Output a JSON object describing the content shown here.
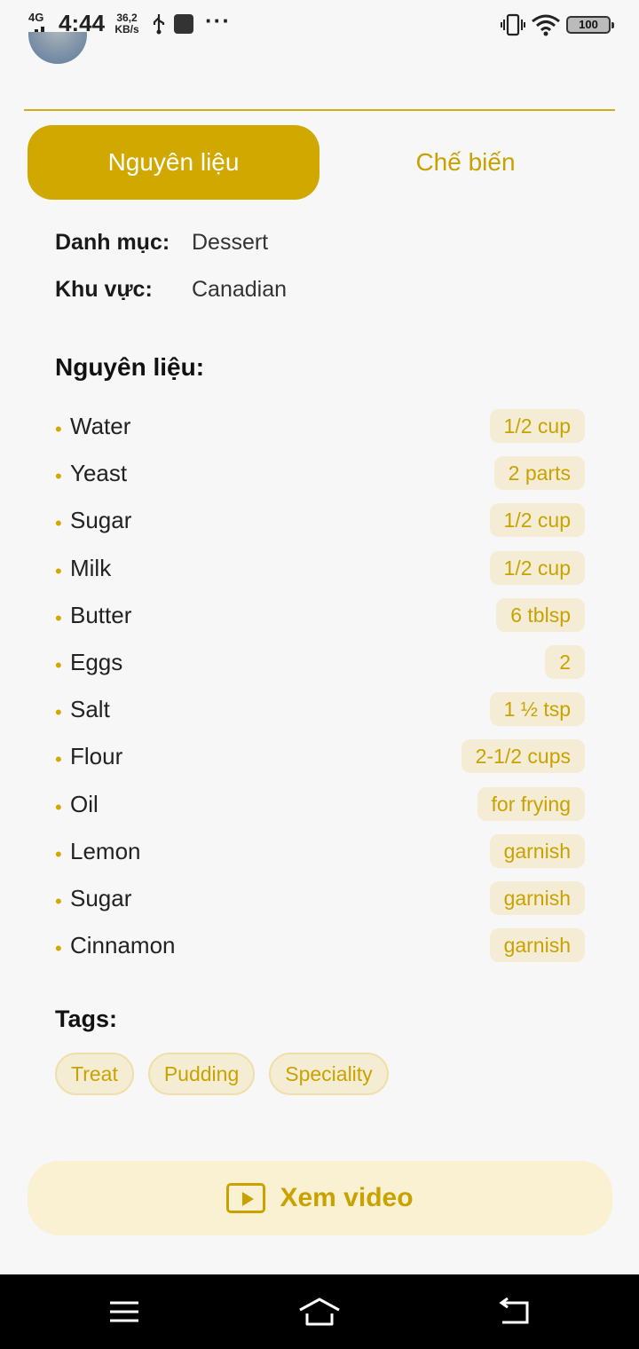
{
  "status_bar": {
    "network": "4G",
    "time": "4:44",
    "speed_value": "36,2",
    "speed_unit": "KB/s",
    "battery": "100",
    "icons": [
      "signal-icon",
      "usb-icon",
      "app-notification-icon",
      "more-notifications-icon",
      "vibrate-icon",
      "wifi-icon",
      "battery-icon"
    ]
  },
  "tabs": [
    {
      "label": "Nguyên liệu",
      "active": true
    },
    {
      "label": "Chế biến",
      "active": false
    }
  ],
  "info": {
    "category_label": "Danh mục:",
    "category_value": "Dessert",
    "area_label": "Khu vực:",
    "area_value": "Canadian"
  },
  "ingredients_title": "Nguyên liệu:",
  "ingredients": [
    {
      "name": "Water",
      "measure": "1/2 cup"
    },
    {
      "name": "Yeast",
      "measure": "2 parts"
    },
    {
      "name": "Sugar",
      "measure": "1/2 cup"
    },
    {
      "name": "Milk",
      "measure": "1/2 cup"
    },
    {
      "name": "Butter",
      "measure": "6 tblsp"
    },
    {
      "name": "Eggs",
      "measure": "2"
    },
    {
      "name": "Salt",
      "measure": "1 ½ tsp"
    },
    {
      "name": "Flour",
      "measure": "2-1/2 cups"
    },
    {
      "name": "Oil",
      "measure": "for frying"
    },
    {
      "name": "Lemon",
      "measure": "garnish"
    },
    {
      "name": "Sugar",
      "measure": "garnish"
    },
    {
      "name": "Cinnamon",
      "measure": "garnish"
    }
  ],
  "tags_title": "Tags:",
  "tags": [
    "Treat",
    "Pudding",
    "Speciality"
  ],
  "video_button": {
    "label": "Xem video",
    "icon": "play-video-icon"
  },
  "colors": {
    "accent": "#d1a800",
    "accent_text": "#c9a200",
    "chip_bg": "#f4ecd4",
    "video_bg": "#f9f1d2"
  },
  "nav_bar": {
    "icons": [
      "recent-apps-icon",
      "home-icon",
      "back-icon"
    ]
  }
}
